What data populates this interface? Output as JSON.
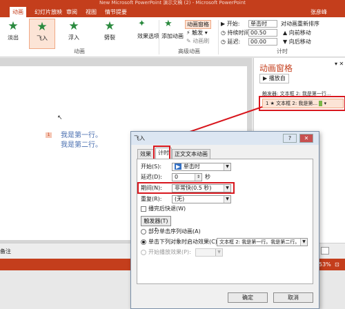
{
  "window": {
    "title": "New Microsoft PowerPoint 演示文稿 (2) - Microsoft PowerPoint"
  },
  "tabs": [
    "文件",
    "开始",
    "插入",
    "设计",
    "切换",
    "动画",
    "幻灯片放映",
    "审阅",
    "视图",
    "情节提要"
  ],
  "user": "张彦峰",
  "ribbon": {
    "effects": [
      "淡出",
      "飞入",
      "浮入",
      "劈裂"
    ],
    "effect_options": "效果选项",
    "add_animation": "添加动画",
    "animation_pane": "动画窗格",
    "trigger": "触发",
    "animation_brush": "动画刷",
    "start_label": "开始:",
    "start_value": "单击时",
    "duration_label": "持续时间:",
    "duration_value": "00.50",
    "delay_label": "延迟:",
    "delay_value": "00.00",
    "reorder_label": "对动画重新排序",
    "move_earlier": "向前移动",
    "move_later": "向后移动",
    "group_animation": "动画",
    "group_advanced": "高级动画",
    "group_timing": "计时"
  },
  "slide": {
    "line1": "我是第一行。",
    "line2": "我是第二行。"
  },
  "pane": {
    "title": "动画窗格",
    "play_button": "播放自",
    "trigger_text": "触发器: 文本框 2: 我是第一行...",
    "item_label": "1 ★ 文本框 2: 我是第...",
    "item_index": "1"
  },
  "notes": {
    "label": "备注"
  },
  "status": {
    "zoom": "53%"
  },
  "dialog": {
    "title": "飞入",
    "help": "?",
    "close": "✕",
    "tabs": [
      "效果",
      "计时",
      "正文文本动画"
    ],
    "start_label": "开始(S):",
    "start_value": "单击时",
    "delay_label": "延迟(D):",
    "delay_value": "0",
    "delay_unit": "秒",
    "duration_label": "期间(N):",
    "duration_value": "非常快(0.5 秒)",
    "repeat_label": "重复(R):",
    "repeat_value": "(无)",
    "rewind_label": "播完后快退(W)",
    "trigger_button": "触发器(T)",
    "opt1": "部分单击序列动画(A)",
    "opt2": "单击下列对象时启动效果(C):",
    "opt2_value": "文本框 2: 我是第一行。我是第二行。",
    "opt3": "开始播放效果(P):",
    "ok": "确定",
    "cancel": "取消"
  }
}
